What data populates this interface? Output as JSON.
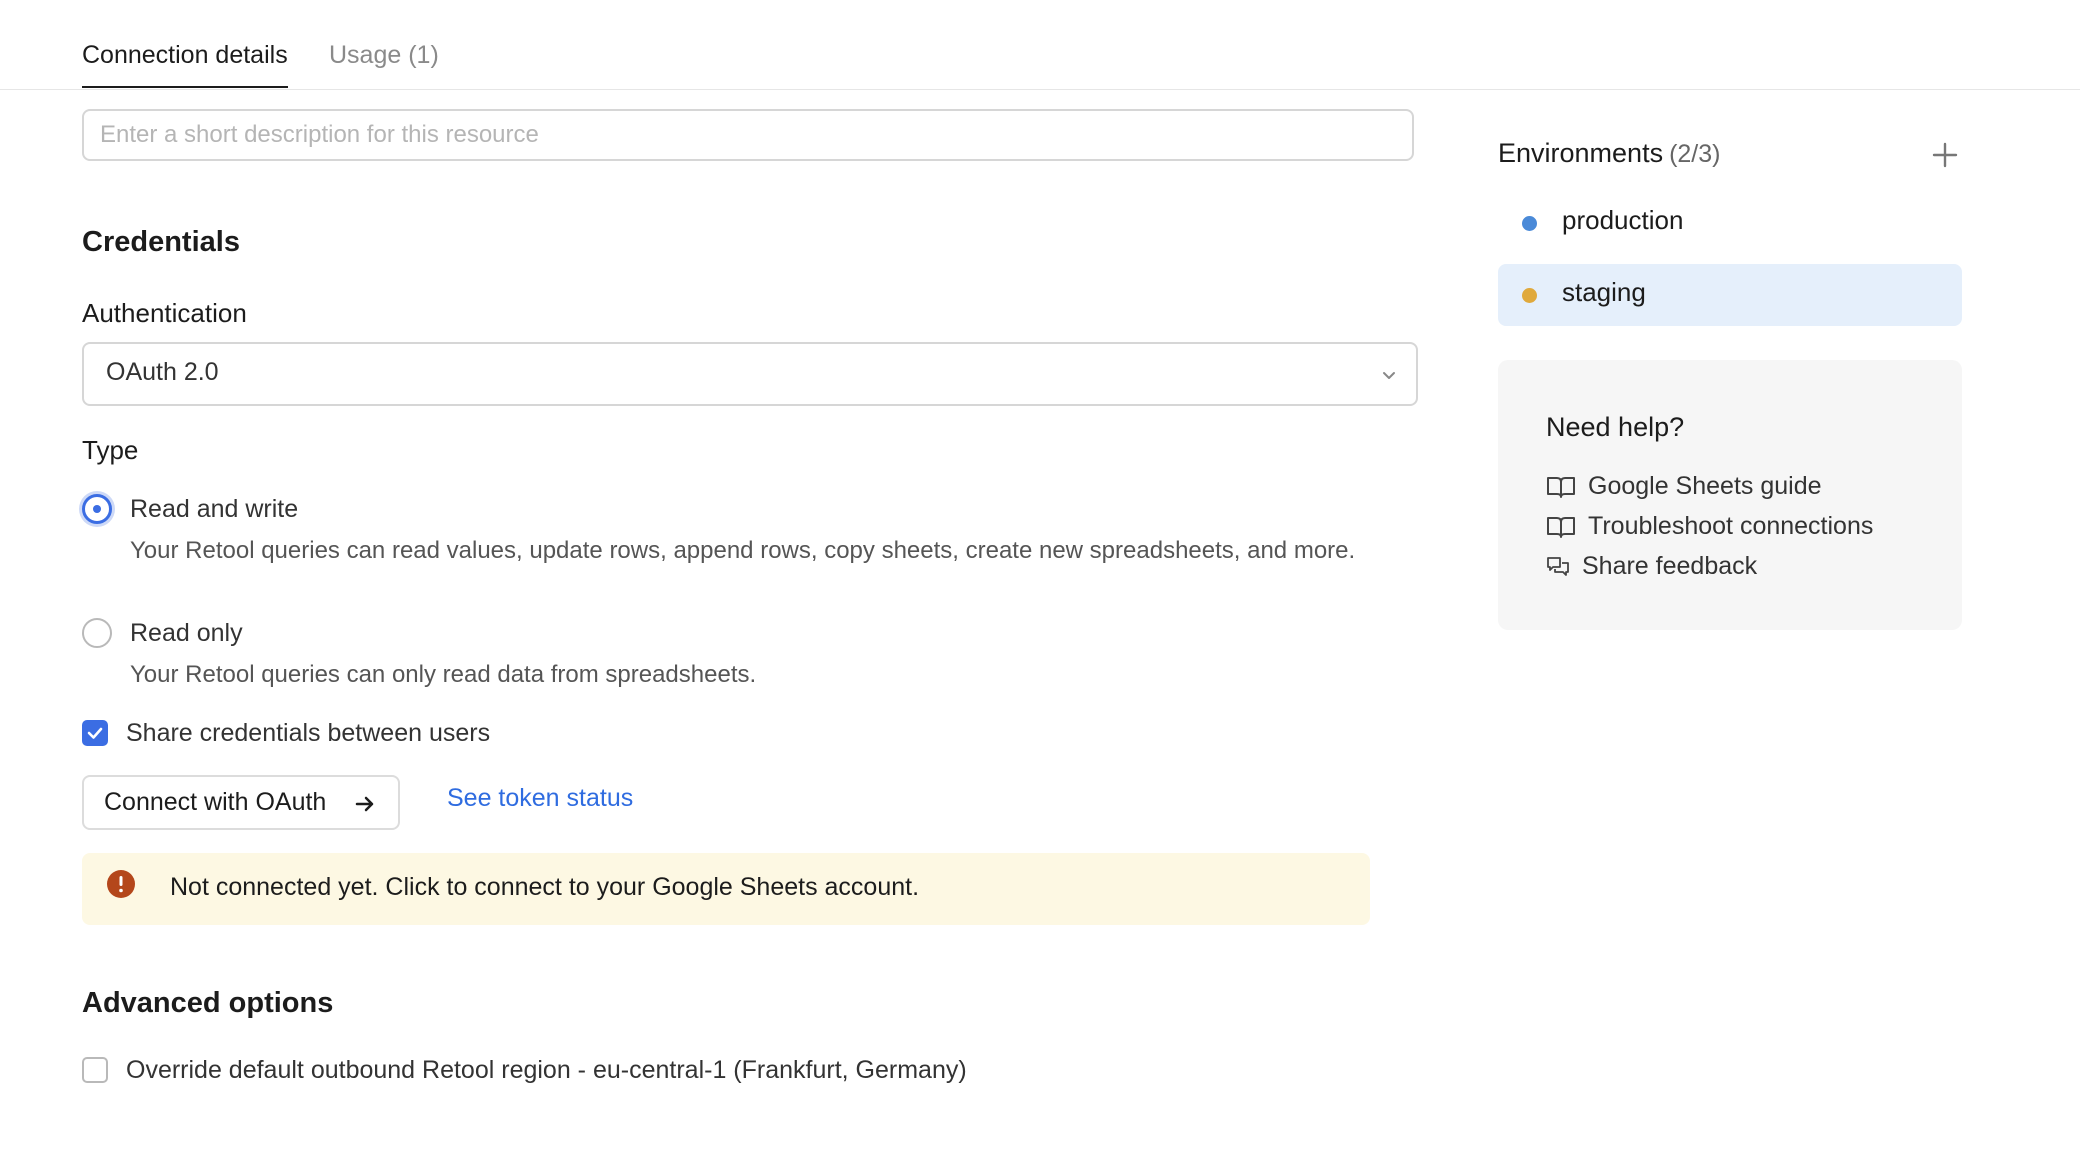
{
  "tabs": [
    {
      "label": "Connection details",
      "active": true
    },
    {
      "label": "Usage",
      "count": "(1)"
    }
  ],
  "description": {
    "placeholder": "Enter a short description for this resource",
    "value": ""
  },
  "credentials": {
    "heading": "Credentials",
    "authentication_label": "Authentication",
    "authentication_value": "OAuth 2.0",
    "type_label": "Type",
    "options": [
      {
        "title": "Read and write",
        "description": "Your Retool queries can read values, update rows, append rows, copy sheets, create new spreadsheets, and more.",
        "selected": true
      },
      {
        "title": "Read only",
        "description": "Your Retool queries can only read data from spreadsheets.",
        "selected": false
      }
    ],
    "share_credentials_label": "Share credentials between users",
    "share_credentials_checked": true,
    "connect_button": "Connect with OAuth",
    "token_link": "See token status",
    "alert": "Not connected yet. Click to connect to your Google Sheets account."
  },
  "advanced": {
    "heading": "Advanced options",
    "override_region_label": "Override default outbound Retool region - eu-central-1 (Frankfurt, Germany)",
    "override_region_checked": false
  },
  "environments": {
    "title": "Environments",
    "count": "(2/3)",
    "items": [
      {
        "name": "production",
        "color": "#4a8ad8",
        "selected": false
      },
      {
        "name": "staging",
        "color": "#e0a93c",
        "selected": true
      }
    ]
  },
  "help": {
    "title": "Need help?",
    "links": [
      {
        "label": "Google Sheets guide",
        "icon": "book-icon"
      },
      {
        "label": "Troubleshoot connections",
        "icon": "book-icon"
      },
      {
        "label": "Share feedback",
        "icon": "chat-bubbles-icon"
      }
    ]
  },
  "colors": {
    "accent": "#3b6de3",
    "link": "#2f6ce0",
    "alert_bg": "#fdf8e3",
    "alert_icon": "#b4471b",
    "selected_env_bg": "#e5effb"
  }
}
